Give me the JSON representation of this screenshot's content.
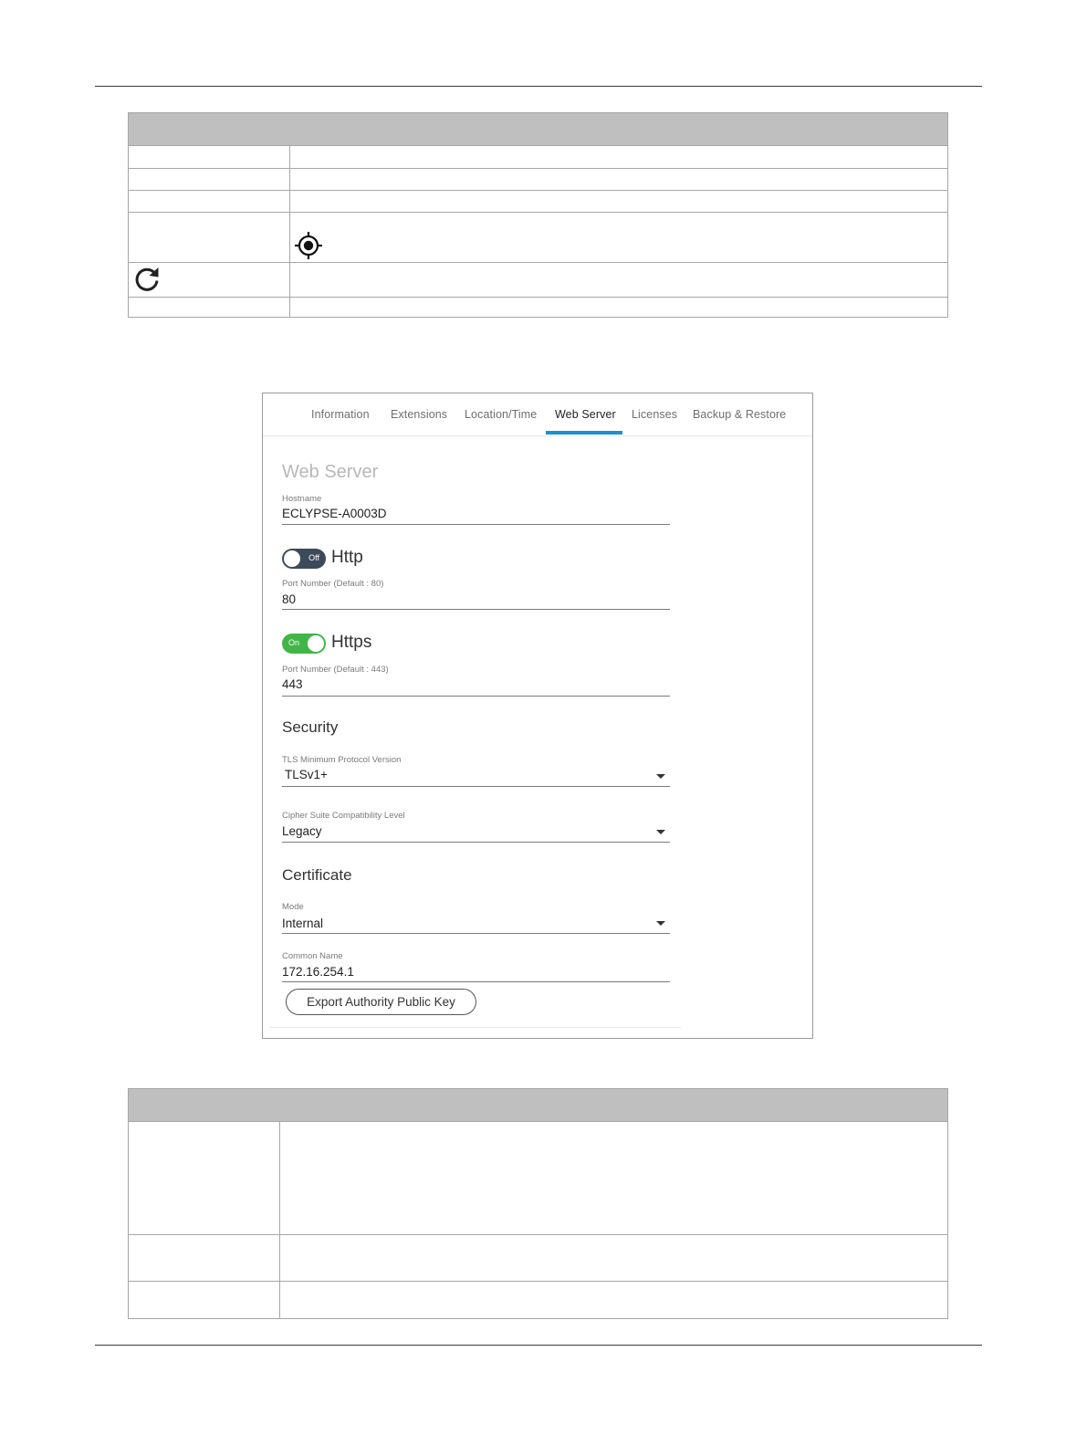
{
  "tabs": [
    {
      "label": "Information"
    },
    {
      "label": "Extensions"
    },
    {
      "label": "Location/Time"
    },
    {
      "label": "Web Server"
    },
    {
      "label": "Licenses"
    },
    {
      "label": "Backup & Restore"
    }
  ],
  "active_tab": "Web Server",
  "web_server": {
    "title": "Web Server",
    "hostname": {
      "label": "Hostname",
      "value": "ECLYPSE-A0003D"
    },
    "http": {
      "title": "Http",
      "toggle_label": "Off",
      "enabled": false,
      "port_label": "Port Number (Default : 80)",
      "port_value": "80"
    },
    "https": {
      "title": "Https",
      "toggle_label": "On",
      "enabled": true,
      "port_label": "Port Number (Default : 443)",
      "port_value": "443"
    },
    "security": {
      "title": "Security",
      "tls": {
        "label": "TLS Minimum Protocol Version",
        "value": "TLSv1+"
      },
      "cipher": {
        "label": "Cipher Suite Compatibility Level",
        "value": "Legacy"
      }
    },
    "certificate": {
      "title": "Certificate",
      "mode": {
        "label": "Mode",
        "value": "Internal"
      },
      "common_name": {
        "label": "Common Name",
        "value": "172.16.254.1"
      },
      "export_button": "Export Authority Public Key"
    }
  },
  "icons": {
    "locate": "crosshair-target-icon",
    "refresh": "refresh-icon"
  },
  "colors": {
    "tab_indicator": "#1e90d0",
    "toggle_on": "#42b549",
    "toggle_off": "#3c4a5a",
    "table_header": "#bfbfbf"
  }
}
